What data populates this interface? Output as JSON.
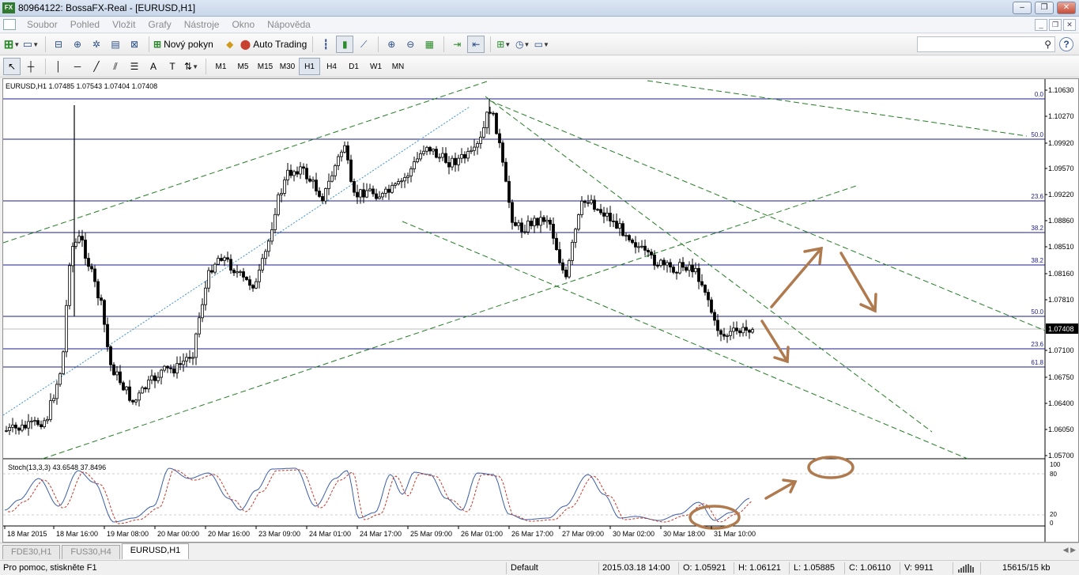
{
  "window": {
    "title": "80964122: BossaFX-Real - [EURUSD,H1]",
    "app_badge": "FX"
  },
  "menu": [
    "Soubor",
    "Pohled",
    "Vložit",
    "Grafy",
    "Nástroje",
    "Okno",
    "Nápověda"
  ],
  "toolbar": {
    "new_order_label": "Nový pokyn",
    "auto_trading_label": "Auto Trading"
  },
  "timeframes": [
    "M1",
    "M5",
    "M15",
    "M30",
    "H1",
    "H4",
    "D1",
    "W1",
    "MN"
  ],
  "selected_timeframe": "H1",
  "search": {
    "placeholder": ""
  },
  "chart": {
    "header": "EURUSD,H1  1.07485 1.07543 1.07404 1.07408",
    "current_price": "1.07408",
    "price_labels": [
      "1.10630",
      "1.10270",
      "1.09920",
      "1.09570",
      "1.09220",
      "1.08860",
      "1.08510",
      "1.08160",
      "1.07810",
      "1.07100",
      "1.06750",
      "1.06400",
      "1.06050",
      "1.05700"
    ],
    "fibo_labels": [
      "0.0",
      "50.0",
      "23.6",
      "38.2",
      "38.2",
      "50.0",
      "23.6",
      "61.8"
    ],
    "time_labels": [
      "18 Mar 2015",
      "18 Mar 16:00",
      "19 Mar 08:00",
      "20 Mar 00:00",
      "20 Mar 16:00",
      "23 Mar 09:00",
      "24 Mar 01:00",
      "24 Mar 17:00",
      "25 Mar 09:00",
      "26 Mar 01:00",
      "26 Mar 17:00",
      "27 Mar 09:00",
      "30 Mar 02:00",
      "30 Mar 18:00",
      "31 Mar 10:00"
    ],
    "indicator_label": "Stoch(13,3,3) 43.6548 37.8496",
    "indicator_levels": [
      "100",
      "80",
      "20",
      "0"
    ],
    "colors": {
      "line_blue": "#1c1c8c",
      "dashed_green": "#237d23",
      "arrow_brown": "#b07a4f",
      "candle": "#000000"
    }
  },
  "tabs": [
    "FDE30,H1",
    "FUS30,H4",
    "EURUSD,H1"
  ],
  "active_tab": "EURUSD,H1",
  "status": {
    "help": "Pro pomoc, stiskněte F1",
    "profile": "Default",
    "datetime": "2015.03.18 14:00",
    "open": "O: 1.05921",
    "high": "H: 1.06121",
    "low": "L: 1.05885",
    "close": "C: 1.06110",
    "volume": "V: 9911",
    "traffic": "15615/15 kb"
  }
}
